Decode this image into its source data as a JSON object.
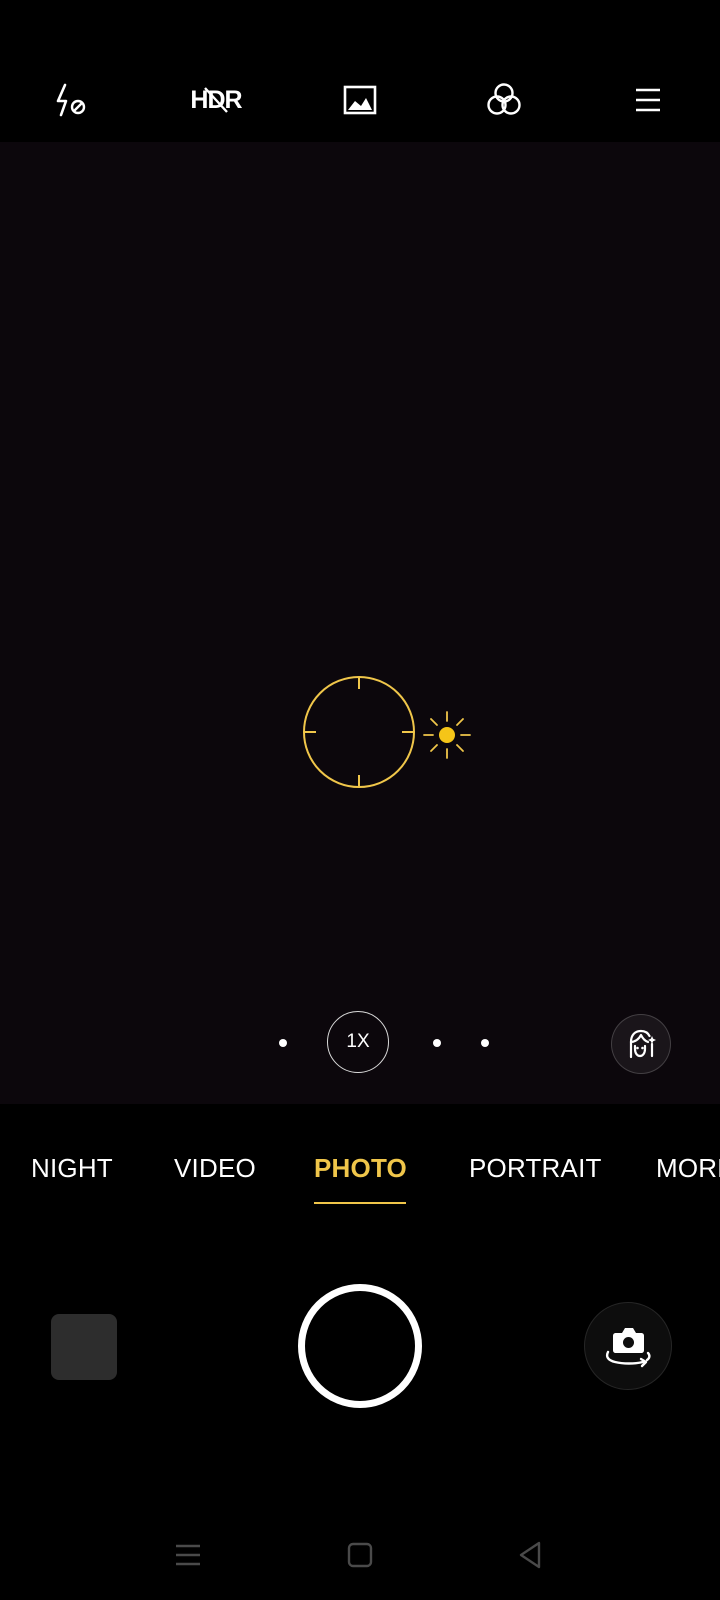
{
  "toolbar": {
    "flash_icon": "flash-off-icon",
    "hdr_label": "HDR",
    "hdr_state": "off",
    "aspect_icon": "image-ratio-icon",
    "filter_icon": "filter-icon",
    "menu_icon": "menu-icon"
  },
  "viewfinder": {
    "focus_icon": "focus-ring-icon",
    "exposure_icon": "sun-exposure-icon",
    "accent_color": "#f0c64a"
  },
  "zoom": {
    "current_label": "1X",
    "dots_left": 1,
    "dots_right": 2
  },
  "beauty_icon": "face-beauty-icon",
  "modes": [
    {
      "label": "NIGHT",
      "active": false
    },
    {
      "label": "VIDEO",
      "active": false
    },
    {
      "label": "PHOTO",
      "active": true
    },
    {
      "label": "PORTRAIT",
      "active": false
    },
    {
      "label": "MORE",
      "active": false
    }
  ],
  "capture": {
    "gallery_icon": "gallery-thumbnail",
    "shutter_icon": "shutter-button",
    "switch_icon": "camera-switch-icon"
  },
  "nav": {
    "recents_icon": "recents-icon",
    "home_icon": "home-icon",
    "back_icon": "back-icon"
  }
}
